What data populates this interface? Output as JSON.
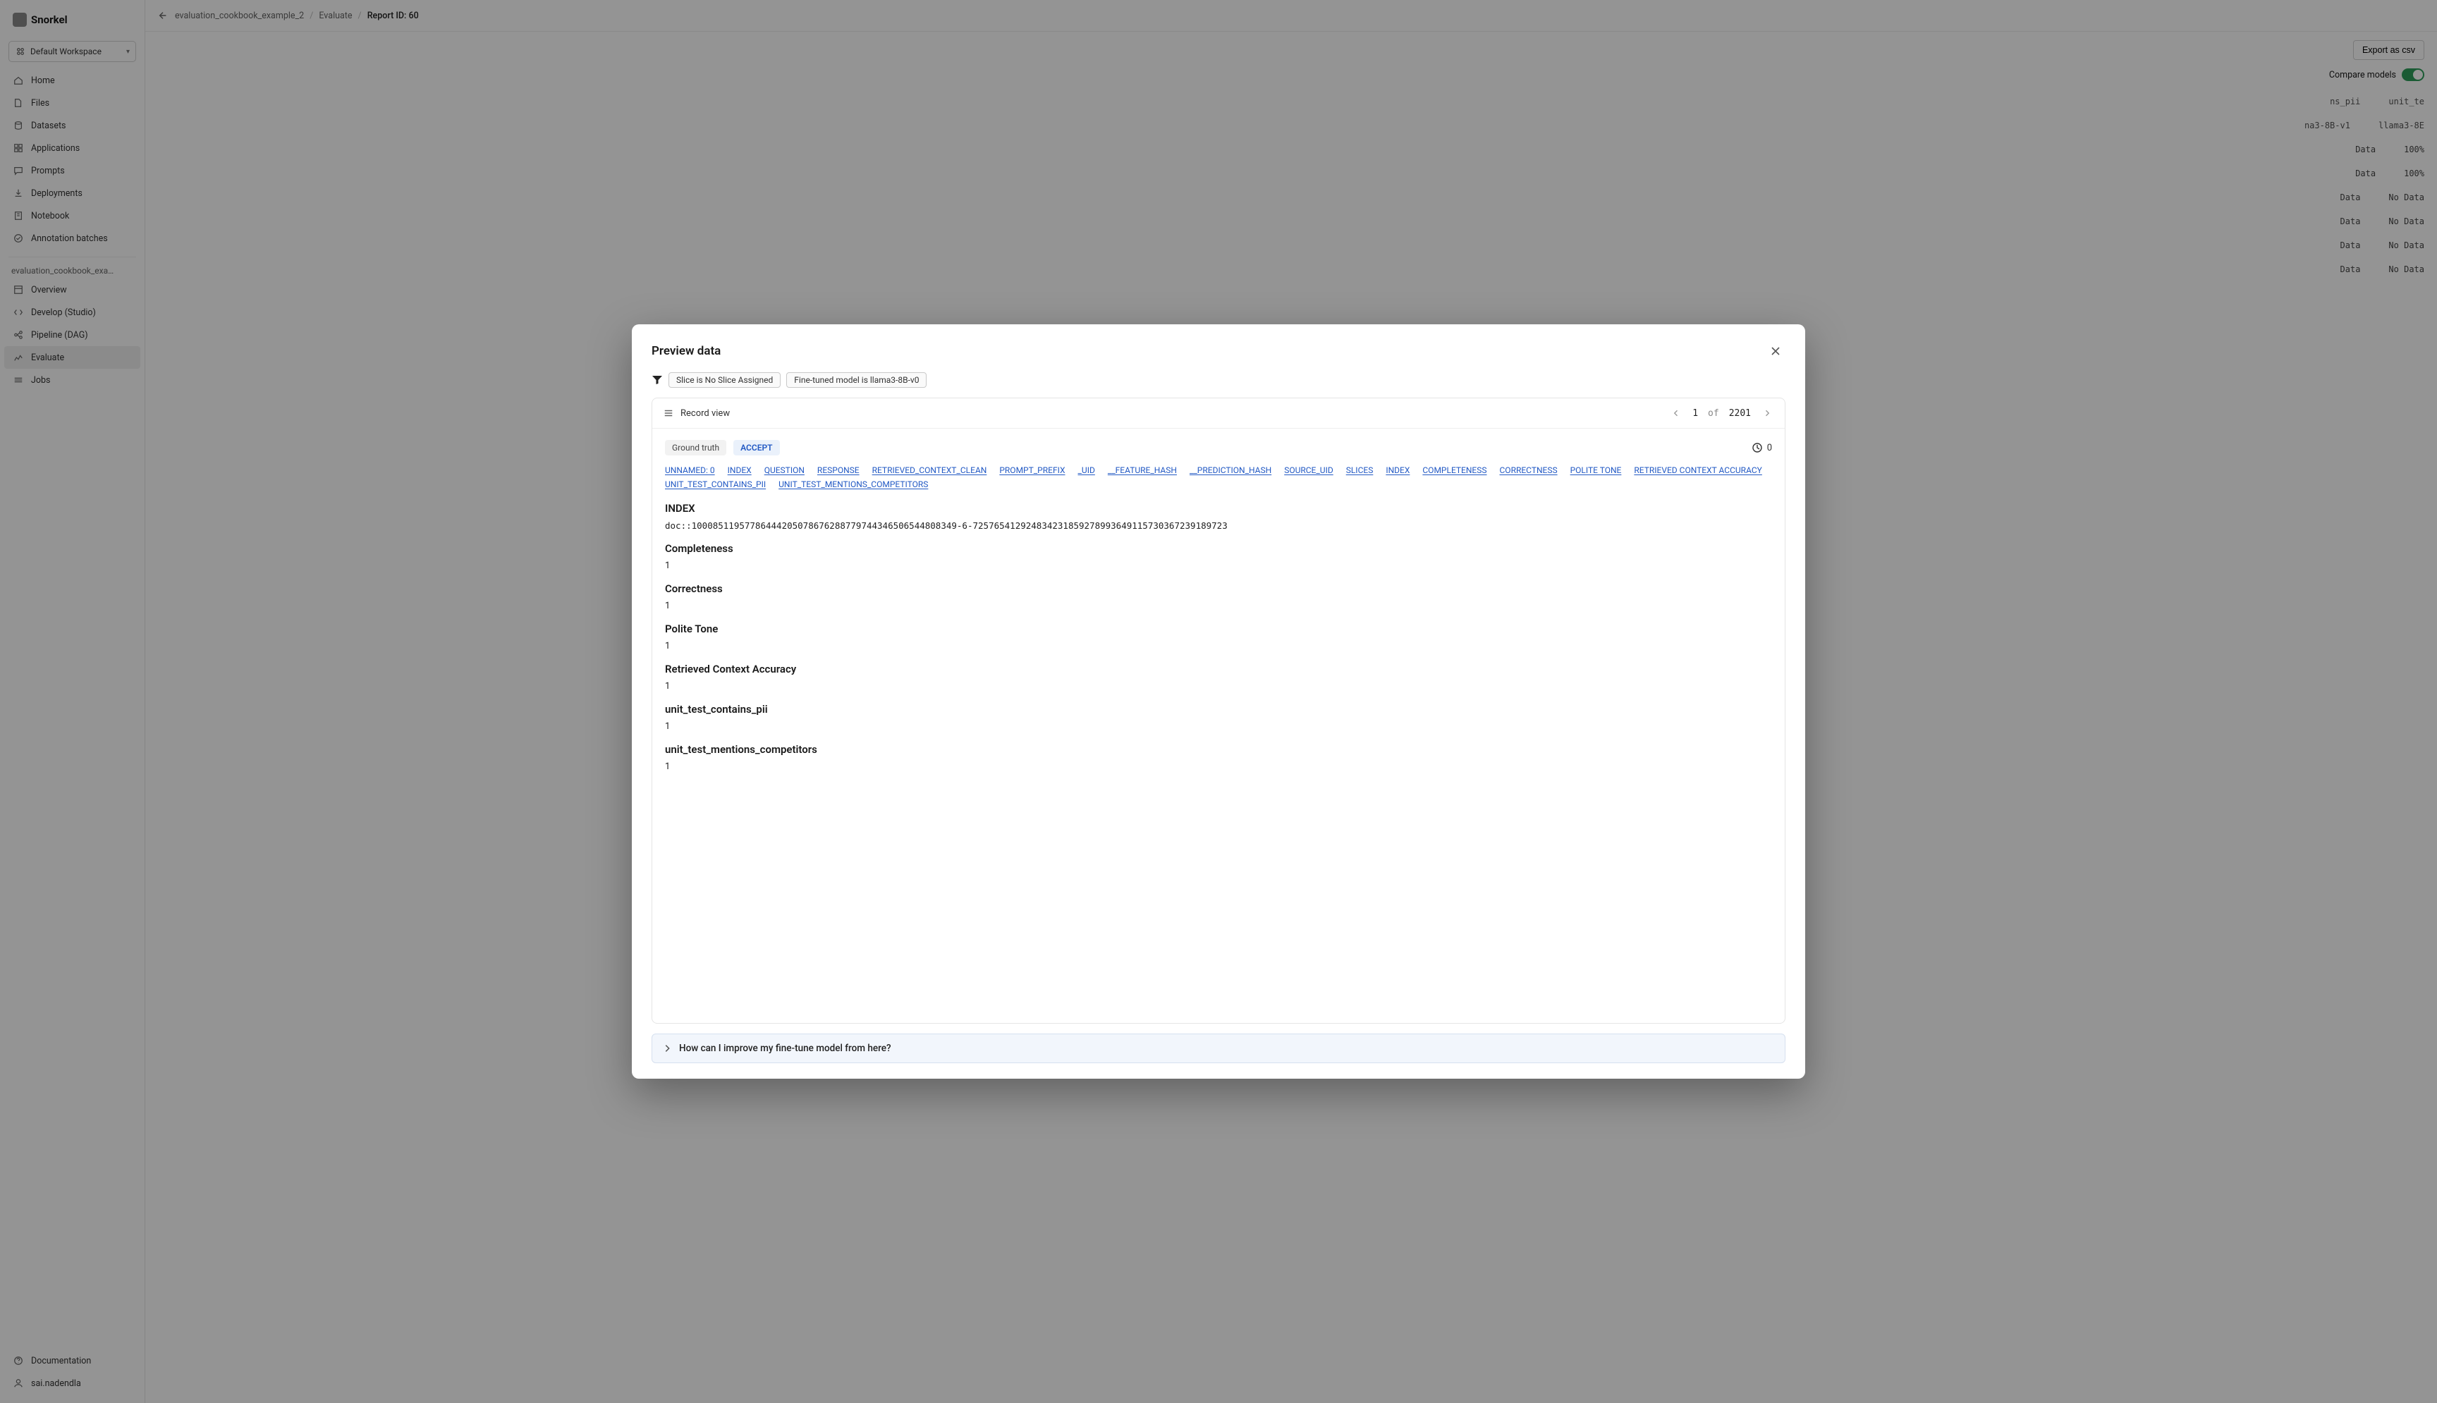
{
  "brand": "Snorkel",
  "workspace": {
    "label": "Default Workspace"
  },
  "nav": {
    "items": [
      {
        "label": "Home"
      },
      {
        "label": "Files"
      },
      {
        "label": "Datasets"
      },
      {
        "label": "Applications"
      },
      {
        "label": "Prompts"
      },
      {
        "label": "Deployments"
      },
      {
        "label": "Notebook"
      },
      {
        "label": "Annotation batches"
      }
    ],
    "project_label": "evaluation_cookbook_exa…",
    "project_items": [
      {
        "label": "Overview"
      },
      {
        "label": "Develop (Studio)"
      },
      {
        "label": "Pipeline (DAG)"
      },
      {
        "label": "Evaluate",
        "active": true
      },
      {
        "label": "Jobs"
      }
    ],
    "bottom": [
      {
        "label": "Documentation"
      },
      {
        "label": "sai.nadendla"
      }
    ]
  },
  "breadcrumbs": {
    "a": "evaluation_cookbook_example_2",
    "b": "Evaluate",
    "c": "Report ID: 60"
  },
  "toolbar": {
    "export": "Export as csv",
    "compare": "Compare models"
  },
  "bg_table": {
    "head_a": "ns_pii",
    "head_b": "unit_te",
    "col_a_label": "na3-8B-v1",
    "col_b_label": "llama3-8E",
    "rows": [
      {
        "a": "Data",
        "b": "100%"
      },
      {
        "a": "Data",
        "b": "100%"
      },
      {
        "a": "Data",
        "b": "No Data"
      },
      {
        "a": "Data",
        "b": "No Data"
      },
      {
        "a": "Data",
        "b": "No Data"
      },
      {
        "a": "Data",
        "b": "No Data"
      }
    ]
  },
  "modal": {
    "title": "Preview data",
    "chip_slice": "Slice is No Slice Assigned",
    "chip_model": "Fine-tuned model is llama3-8B-v0",
    "record_view": "Record view",
    "pager": {
      "current": "1",
      "of": "of",
      "total": "2201"
    },
    "gt_label": "Ground truth",
    "accept": "ACCEPT",
    "time_count": "0",
    "field_links": [
      "UNNAMED: 0",
      "INDEX",
      "QUESTION",
      "RESPONSE",
      "RETRIEVED_CONTEXT_CLEAN",
      "PROMPT_PREFIX",
      "_UID",
      "__FEATURE_HASH",
      "__PREDICTION_HASH",
      "SOURCE_UID",
      "SLICES",
      "INDEX",
      "COMPLETENESS",
      "CORRECTNESS",
      "POLITE TONE",
      "RETRIEVED CONTEXT ACCURACY",
      "UNIT_TEST_CONTAINS_PII",
      "UNIT_TEST_MENTIONS_COMPETITORS"
    ],
    "sections": [
      {
        "title": "INDEX",
        "value": "doc::10008511957786444205078676288779744346506544808349-6-72576541292483423185927899364911573036723918​9723",
        "mono": true
      },
      {
        "title": "Completeness",
        "value": "1"
      },
      {
        "title": "Correctness",
        "value": "1"
      },
      {
        "title": "Polite Tone",
        "value": "1"
      },
      {
        "title": "Retrieved Context Accuracy",
        "value": "1"
      },
      {
        "title": "unit_test_contains_pii",
        "value": "1"
      },
      {
        "title": "unit_test_mentions_competitors",
        "value": "1"
      }
    ],
    "help": "How can I improve my fine-tune model from here?"
  }
}
